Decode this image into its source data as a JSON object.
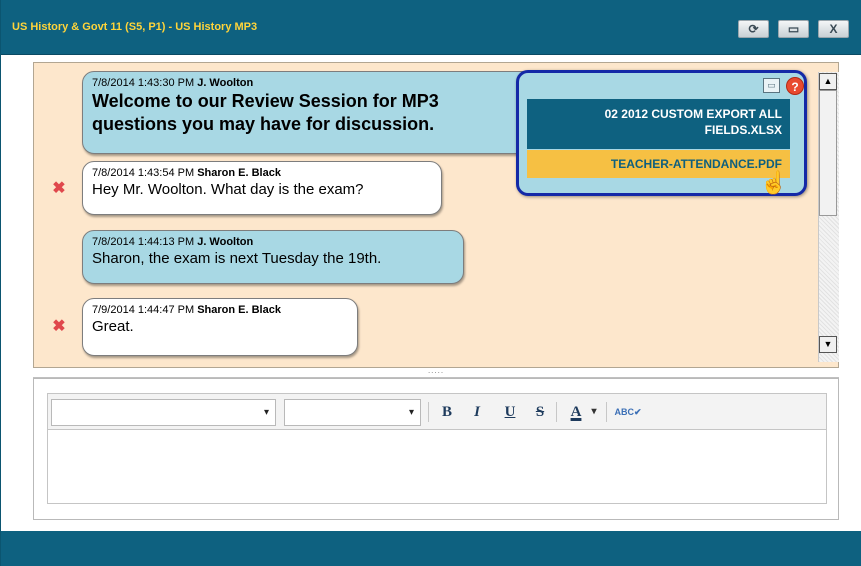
{
  "window": {
    "title": "US History & Govt 11 (S5, P1) - US History MP3",
    "buttons": {
      "refresh": "⟳",
      "maximize": "▭",
      "close": "X"
    }
  },
  "messages": [
    {
      "sender_type": "teacher",
      "timestamp": "7/8/2014 1:43:30 PM",
      "author": "J. Woolton",
      "line1": "Welcome to our Review Session for MP3",
      "line2": "questions you may have for discussion."
    },
    {
      "sender_type": "student",
      "timestamp": "7/8/2014 1:43:54 PM",
      "author": "Sharon E. Black",
      "text": "Hey Mr. Woolton. What day is the exam?"
    },
    {
      "sender_type": "teacher",
      "timestamp": "7/8/2014 1:44:13 PM",
      "author": "J. Woolton",
      "text": "Sharon, the exam is next Tuesday the 19th."
    },
    {
      "sender_type": "student",
      "timestamp": "7/9/2014 1:44:47 PM",
      "author": "Sharon E. Black",
      "text": "Great."
    }
  ],
  "icons": {
    "delete": "✖",
    "help": "?",
    "scroll_up": "▲",
    "scroll_down": "▼",
    "cursor": "☝",
    "doc": "▭"
  },
  "attachments_popup": {
    "files": [
      "02 2012 CUSTOM EXPORT ALL FIELDS.XLSX",
      "TEACHER-ATTENDANCE.PDF"
    ]
  },
  "splitter": {
    "grip": "....."
  },
  "editor": {
    "font_select": "",
    "size_select": "",
    "toolbar": {
      "bold": "B",
      "italic": "I",
      "underline": "U",
      "strike": "S",
      "font_color": "A",
      "dropdown": "▾",
      "spellcheck": "ABC✔"
    },
    "text": ""
  },
  "colors": {
    "chrome": "#0e6180",
    "title_text": "#ffd43a",
    "chat_bg": "#fde7cc",
    "teacher_bubble": "#a8d8e4",
    "student_bubble": "#ffffff",
    "popup_highlight": "#f6c043",
    "popup_border": "#1429a7"
  }
}
